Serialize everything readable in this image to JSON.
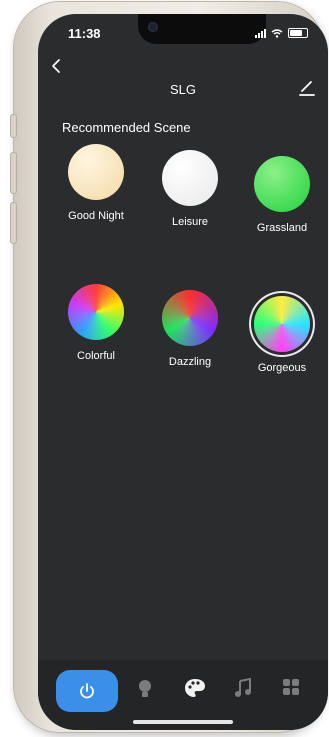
{
  "status_bar": {
    "time": "11:38"
  },
  "header": {
    "title": "SLG",
    "back_icon": "chevron-left-icon",
    "edit_icon": "edit-pencil-icon"
  },
  "section_title": "Recommended Scene",
  "scenes": [
    {
      "label": "Good Night",
      "colors": [
        "#fff6e0",
        "#f2d9a6"
      ],
      "selected": false
    },
    {
      "label": "Leisure",
      "colors": [
        "#ffffff",
        "#e8e8e8"
      ],
      "selected": false
    },
    {
      "label": "Grassland",
      "colors": [
        "#8cf08a",
        "#1fd23b"
      ],
      "selected": false
    },
    {
      "label": "Colorful",
      "colors": [
        "#ff3b3b",
        "#ffe600",
        "#2bff6a",
        "#2f9bff",
        "#c43cff"
      ],
      "selected": false
    },
    {
      "label": "Dazzling",
      "colors": [
        "#ff2d2d",
        "#7a2dff",
        "#20e05a"
      ],
      "selected": false
    },
    {
      "label": "Gorgeous",
      "colors": [
        "#ffec3b",
        "#23e6ff",
        "#ff3df0",
        "#2bff7a"
      ],
      "selected": true
    }
  ],
  "tabbar": {
    "tabs": [
      {
        "icon": "power-icon",
        "active": true
      },
      {
        "icon": "bulb-icon",
        "active": false
      },
      {
        "icon": "palette-icon",
        "active": false
      },
      {
        "icon": "music-icon",
        "active": false
      },
      {
        "icon": "grid-icon",
        "active": false
      }
    ]
  },
  "colors": {
    "screen_bg": "#2b2c2e",
    "accent": "#3b8fe8",
    "text": "#ffffff"
  }
}
